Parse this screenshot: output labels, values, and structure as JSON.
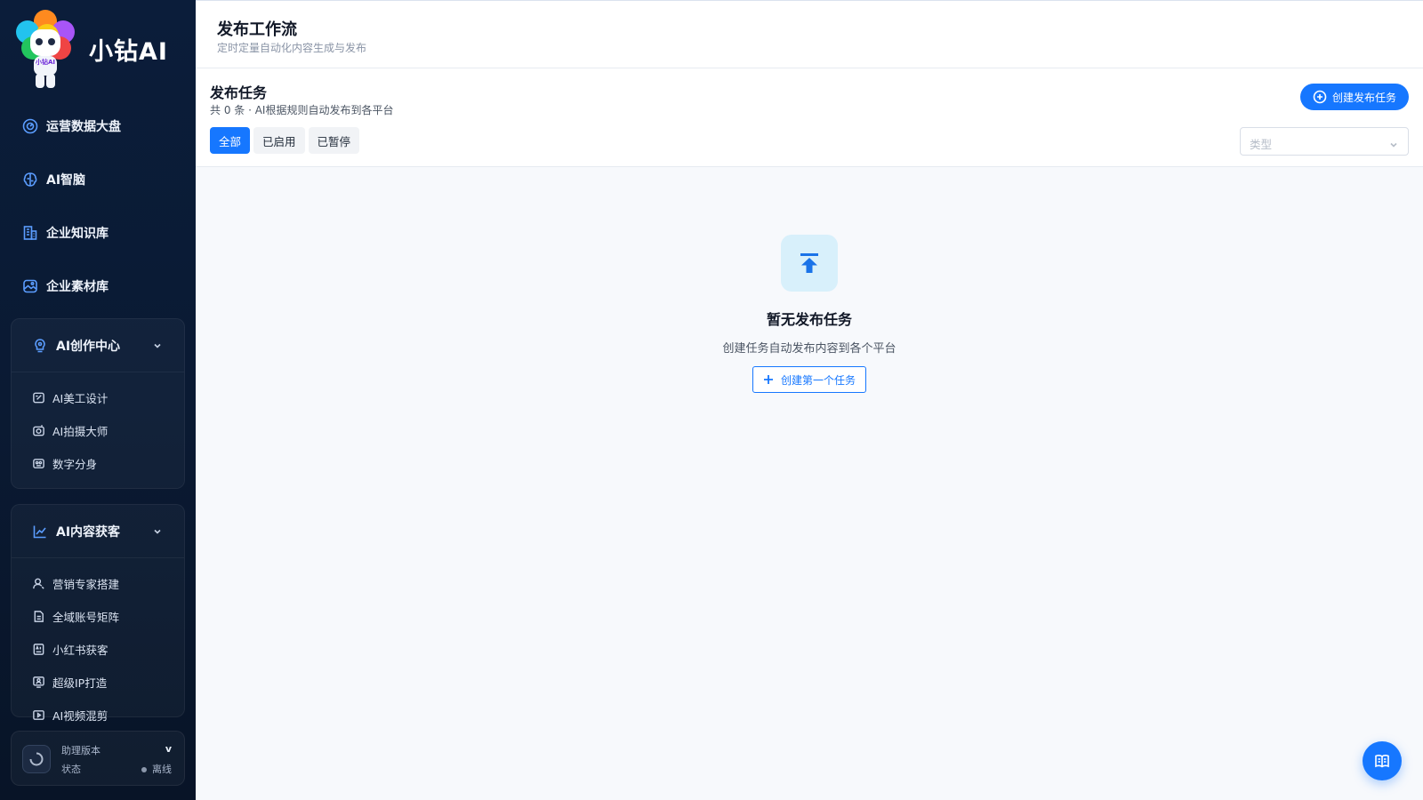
{
  "brand": {
    "name": "小钻AI",
    "logo_tag": "小钻AI"
  },
  "sidebar": {
    "top_items": [
      {
        "label": "运营数据大盘",
        "icon": "dashboard-icon"
      },
      {
        "label": "AI智脑",
        "icon": "brain-icon"
      },
      {
        "label": "企业知识库",
        "icon": "building-icon"
      },
      {
        "label": "企业素材库",
        "icon": "image-icon"
      }
    ],
    "groups": [
      {
        "label": "AI创作中心",
        "icon": "bulb-icon",
        "items": [
          {
            "label": "AI美工设计",
            "icon": "design-icon"
          },
          {
            "label": "AI拍摄大师",
            "icon": "camera-icon"
          },
          {
            "label": "数字分身",
            "icon": "avatar-icon"
          }
        ]
      },
      {
        "label": "AI内容获客",
        "icon": "chart-icon",
        "items": [
          {
            "label": "营销专家搭建",
            "icon": "user-icon"
          },
          {
            "label": "全域账号矩阵",
            "icon": "document-icon"
          },
          {
            "label": "小红书获客",
            "icon": "ai-box-icon"
          },
          {
            "label": "超级IP打造",
            "icon": "monitor-user-icon"
          },
          {
            "label": "AI视频混剪",
            "icon": "video-icon"
          }
        ]
      }
    ],
    "assistant": {
      "version_label": "助理版本",
      "version_value": "v",
      "status_label": "状态",
      "status_value": "离线"
    }
  },
  "header": {
    "title": "发布工作流",
    "subtitle": "定时定量自动化内容生成与发布"
  },
  "panel": {
    "title": "发布任务",
    "subtitle": "共 0 条 · AI根据规则自动发布到各平台",
    "create_label": "创建发布任务",
    "tabs": [
      {
        "label": "全部",
        "active": true
      },
      {
        "label": "已启用",
        "active": false
      },
      {
        "label": "已暂停",
        "active": false
      }
    ],
    "type_placeholder": "类型"
  },
  "empty_state": {
    "title": "暂无发布任务",
    "description": "创建任务自动发布内容到各个平台",
    "button_label": "创建第一个任务"
  },
  "colors": {
    "primary": "#1677ff",
    "sidebar_bg": "#0b1d3a",
    "sidebar_icon": "#5b9dff"
  }
}
